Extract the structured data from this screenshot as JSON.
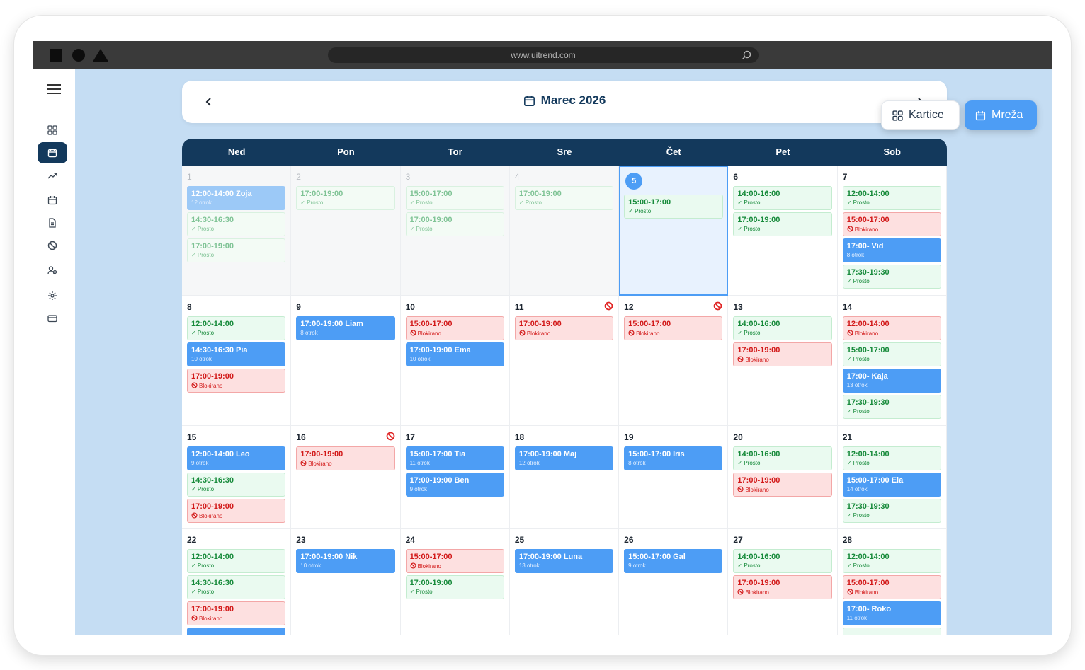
{
  "browser": {
    "url": "www.uitrend.com"
  },
  "sidebar": {
    "items": [
      "dashboard-icon",
      "calendar-icon",
      "trend-icon",
      "calendar-alt-icon",
      "document-icon",
      "blocked-icon",
      "users-icon",
      "settings-icon",
      "card-icon"
    ]
  },
  "header": {
    "month_title": "Marec 2026"
  },
  "view_buttons": {
    "cards_label": "Kartice",
    "grid_label": "Mreža"
  },
  "weekdays": [
    "Ned",
    "Pon",
    "Tor",
    "Sre",
    "Čet",
    "Pet",
    "Sob"
  ],
  "today": 5,
  "weeks": [
    [
      {
        "day": "1",
        "past": true,
        "events": [
          {
            "time": "12:00-14:00 Zoja",
            "sub": "12 otrok",
            "status": "booked"
          },
          {
            "time": "14:30-16:30",
            "sub": "✓ Prosto",
            "status": "free"
          },
          {
            "time": "17:00-19:00",
            "sub": "✓ Prosto",
            "status": "free"
          }
        ]
      },
      {
        "day": "2",
        "past": true,
        "events": [
          {
            "time": "17:00-19:00",
            "sub": "✓ Prosto",
            "status": "free"
          }
        ]
      },
      {
        "day": "3",
        "past": true,
        "events": [
          {
            "time": "15:00-17:00",
            "sub": "✓ Prosto",
            "status": "free"
          },
          {
            "time": "17:00-19:00",
            "sub": "✓ Prosto",
            "status": "free"
          }
        ]
      },
      {
        "day": "4",
        "past": true,
        "events": [
          {
            "time": "17:00-19:00",
            "sub": "✓ Prosto",
            "status": "free"
          }
        ]
      },
      {
        "day": "5",
        "today": true,
        "events": [
          {
            "time": "15:00-17:00",
            "sub": "✓ Prosto",
            "status": "free"
          }
        ]
      },
      {
        "day": "6",
        "events": [
          {
            "time": "14:00-16:00",
            "sub": "✓ Prosto",
            "status": "free"
          },
          {
            "time": "17:00-19:00",
            "sub": "✓ Prosto",
            "status": "free"
          }
        ]
      },
      {
        "day": "7",
        "events": [
          {
            "time": "12:00-14:00",
            "sub": "✓ Prosto",
            "status": "free"
          },
          {
            "time": "15:00-17:00",
            "sub": "Blokirano",
            "status": "blocked"
          },
          {
            "time": "17:00- Vid",
            "sub": "8 otrok",
            "status": "booked"
          },
          {
            "time": "17:30-19:30",
            "sub": "✓ Prosto",
            "status": "free"
          }
        ]
      }
    ],
    [
      {
        "day": "8",
        "events": [
          {
            "time": "12:00-14:00",
            "sub": "✓ Prosto",
            "status": "free"
          },
          {
            "time": "14:30-16:30 Pia",
            "sub": "10 otrok",
            "status": "booked"
          },
          {
            "time": "17:00-19:00",
            "sub": "Blokirano",
            "status": "blocked"
          }
        ]
      },
      {
        "day": "9",
        "events": [
          {
            "time": "17:00-19:00 Liam",
            "sub": "8 otrok",
            "status": "booked"
          }
        ]
      },
      {
        "day": "10",
        "events": [
          {
            "time": "15:00-17:00",
            "sub": "Blokirano",
            "status": "blocked"
          },
          {
            "time": "17:00-19:00 Ema",
            "sub": "10 otrok",
            "status": "booked"
          }
        ]
      },
      {
        "day": "11",
        "blocked": true,
        "events": [
          {
            "time": "17:00-19:00",
            "sub": "Blokirano",
            "status": "blocked"
          }
        ]
      },
      {
        "day": "12",
        "blocked": true,
        "events": [
          {
            "time": "15:00-17:00",
            "sub": "Blokirano",
            "status": "blocked"
          }
        ]
      },
      {
        "day": "13",
        "events": [
          {
            "time": "14:00-16:00",
            "sub": "✓ Prosto",
            "status": "free"
          },
          {
            "time": "17:00-19:00",
            "sub": "Blokirano",
            "status": "blocked"
          }
        ]
      },
      {
        "day": "14",
        "events": [
          {
            "time": "12:00-14:00",
            "sub": "Blokirano",
            "status": "blocked"
          },
          {
            "time": "15:00-17:00",
            "sub": "✓ Prosto",
            "status": "free"
          },
          {
            "time": "17:00- Kaja",
            "sub": "13 otrok",
            "status": "booked"
          },
          {
            "time": "17:30-19:30",
            "sub": "✓ Prosto",
            "status": "free"
          }
        ]
      }
    ],
    [
      {
        "day": "15",
        "events": [
          {
            "time": "12:00-14:00 Leo",
            "sub": "9 otrok",
            "status": "booked"
          },
          {
            "time": "14:30-16:30",
            "sub": "✓ Prosto",
            "status": "free"
          },
          {
            "time": "17:00-19:00",
            "sub": "Blokirano",
            "status": "blocked"
          }
        ]
      },
      {
        "day": "16",
        "blocked": true,
        "events": [
          {
            "time": "17:00-19:00",
            "sub": "Blokirano",
            "status": "blocked"
          }
        ]
      },
      {
        "day": "17",
        "events": [
          {
            "time": "15:00-17:00 Tia",
            "sub": "11 otrok",
            "status": "booked"
          },
          {
            "time": "17:00-19:00 Ben",
            "sub": "9 otrok",
            "status": "booked"
          }
        ]
      },
      {
        "day": "18",
        "events": [
          {
            "time": "17:00-19:00 Maj",
            "sub": "12 otrok",
            "status": "booked"
          }
        ]
      },
      {
        "day": "19",
        "events": [
          {
            "time": "15:00-17:00 Iris",
            "sub": "8 otrok",
            "status": "booked"
          }
        ]
      },
      {
        "day": "20",
        "events": [
          {
            "time": "14:00-16:00",
            "sub": "✓ Prosto",
            "status": "free"
          },
          {
            "time": "17:00-19:00",
            "sub": "Blokirano",
            "status": "blocked"
          }
        ]
      },
      {
        "day": "21",
        "events": [
          {
            "time": "12:00-14:00",
            "sub": "✓ Prosto",
            "status": "free"
          },
          {
            "time": "15:00-17:00 Ela",
            "sub": "14 otrok",
            "status": "booked"
          },
          {
            "time": "17:30-19:30",
            "sub": "✓ Prosto",
            "status": "free"
          }
        ]
      }
    ],
    [
      {
        "day": "22",
        "events": [
          {
            "time": "12:00-14:00",
            "sub": "✓ Prosto",
            "status": "free"
          },
          {
            "time": "14:30-16:30",
            "sub": "✓ Prosto",
            "status": "free"
          },
          {
            "time": "17:00-19:00",
            "sub": "Blokirano",
            "status": "blocked"
          },
          {
            "time": "",
            "sub": "",
            "status": "booked"
          }
        ]
      },
      {
        "day": "23",
        "events": [
          {
            "time": "17:00-19:00 Nik",
            "sub": "10 otrok",
            "status": "booked"
          }
        ]
      },
      {
        "day": "24",
        "events": [
          {
            "time": "15:00-17:00",
            "sub": "Blokirano",
            "status": "blocked"
          },
          {
            "time": "17:00-19:00",
            "sub": "✓ Prosto",
            "status": "free"
          }
        ]
      },
      {
        "day": "25",
        "events": [
          {
            "time": "17:00-19:00 Luna",
            "sub": "13 otrok",
            "status": "booked"
          }
        ]
      },
      {
        "day": "26",
        "events": [
          {
            "time": "15:00-17:00 Gal",
            "sub": "9 otrok",
            "status": "booked"
          }
        ]
      },
      {
        "day": "27",
        "events": [
          {
            "time": "14:00-16:00",
            "sub": "✓ Prosto",
            "status": "free"
          },
          {
            "time": "17:00-19:00",
            "sub": "Blokirano",
            "status": "blocked"
          }
        ]
      },
      {
        "day": "28",
        "events": [
          {
            "time": "12:00-14:00",
            "sub": "✓ Prosto",
            "status": "free"
          },
          {
            "time": "15:00-17:00",
            "sub": "Blokirano",
            "status": "blocked"
          },
          {
            "time": "17:00- Roko",
            "sub": "11 otrok",
            "status": "booked"
          },
          {
            "time": "",
            "sub": "",
            "status": "free"
          }
        ]
      }
    ]
  ],
  "colors": {
    "navy": "#13395c",
    "accent": "#4d9df5",
    "free": "#168a3a",
    "blocked": "#d21919",
    "background": "#c5ddf3"
  }
}
